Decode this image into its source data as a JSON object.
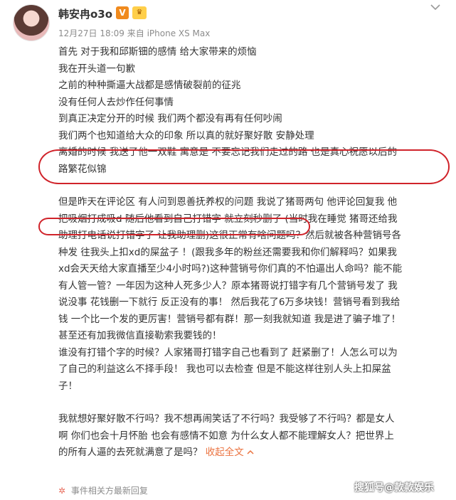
{
  "header": {
    "username": "韩安冉o3o",
    "vip_badge": "V",
    "level_badge": "♛",
    "meta": "12月27日 18:09 来自 iPhone XS Max"
  },
  "post": {
    "lines": [
      "首先 对于我和邱斯钿的感情 给大家带来的烦恼",
      "我在开头道一句歉",
      "之前的种种撕逼大战都是感情破裂前的征兆",
      "没有任何人去炒作任何事情",
      "到真正决定分开的时候 我们两个都没有再有任何吵闹",
      "我们两个也知道给大众的印象 所以真的就好聚好散 安静处理"
    ],
    "divorce_line_1": "离婚的时候 我送了他一双鞋 寓意是 不要忘记我们走过的路 也是真心祝愿以后的",
    "divorce_line_2": "路繁花似锦",
    "para2_lines": [
      "但是昨天在评论区 有人问到恩善抚养权的问题 我说了猪哥两句 他评论回复我 他",
      "把吸烟打成吸d 随后他看到自己打错字 就立刻秒删了 (当时我在睡觉 猪哥还给我",
      "助理打电话说打错字了 让我助理删)这很正常有啥问题吗？然后就被各种营销号各",
      "种发 往我头上扣xd的屎盆子 ！(跟我多年的粉丝还需要我和你们解释吗？如果我",
      "xd会天天给大家直播至少4小时吗?)这种营销号你们真的不怕逼出人命吗？能不能",
      "有人管一管？一年因为这种人死多少人？原本猪哥说打错字有几个营销号发了 我",
      "说没事 花钱删一下就行 反正没有的事！ 然后我花了6万多块钱！营销号看到我给",
      "钱 一个比一个发的更厉害！营销号都有群！那一刻我就知道 我是进了骗子堆了！",
      "甚至还有加我微信直接勒索我要钱的！",
      "谁没有打错个字的时候？人家猪哥打错字自己也看到了 赶紧删了！人怎么可以为",
      "了自己的利益这么不择手段！ 我也可以去检查 但是不能这样往别人头上扣屎盆",
      "子！"
    ],
    "para3_lines": [
      "我就想好聚好散不行吗？我不想再闹笑话了不行吗？我受够了不行吗？都是女人",
      "啊 你们也会十月怀胎 也会有感情不如意 为什么女人都不能理解女人？把世界上",
      "的所有人逼的去死就满意了是吗？"
    ],
    "collapse_link": "收起全文"
  },
  "footer": {
    "related_link": "事件相关方最新回复"
  },
  "watermark": "搜狐号@款款娱乐"
}
